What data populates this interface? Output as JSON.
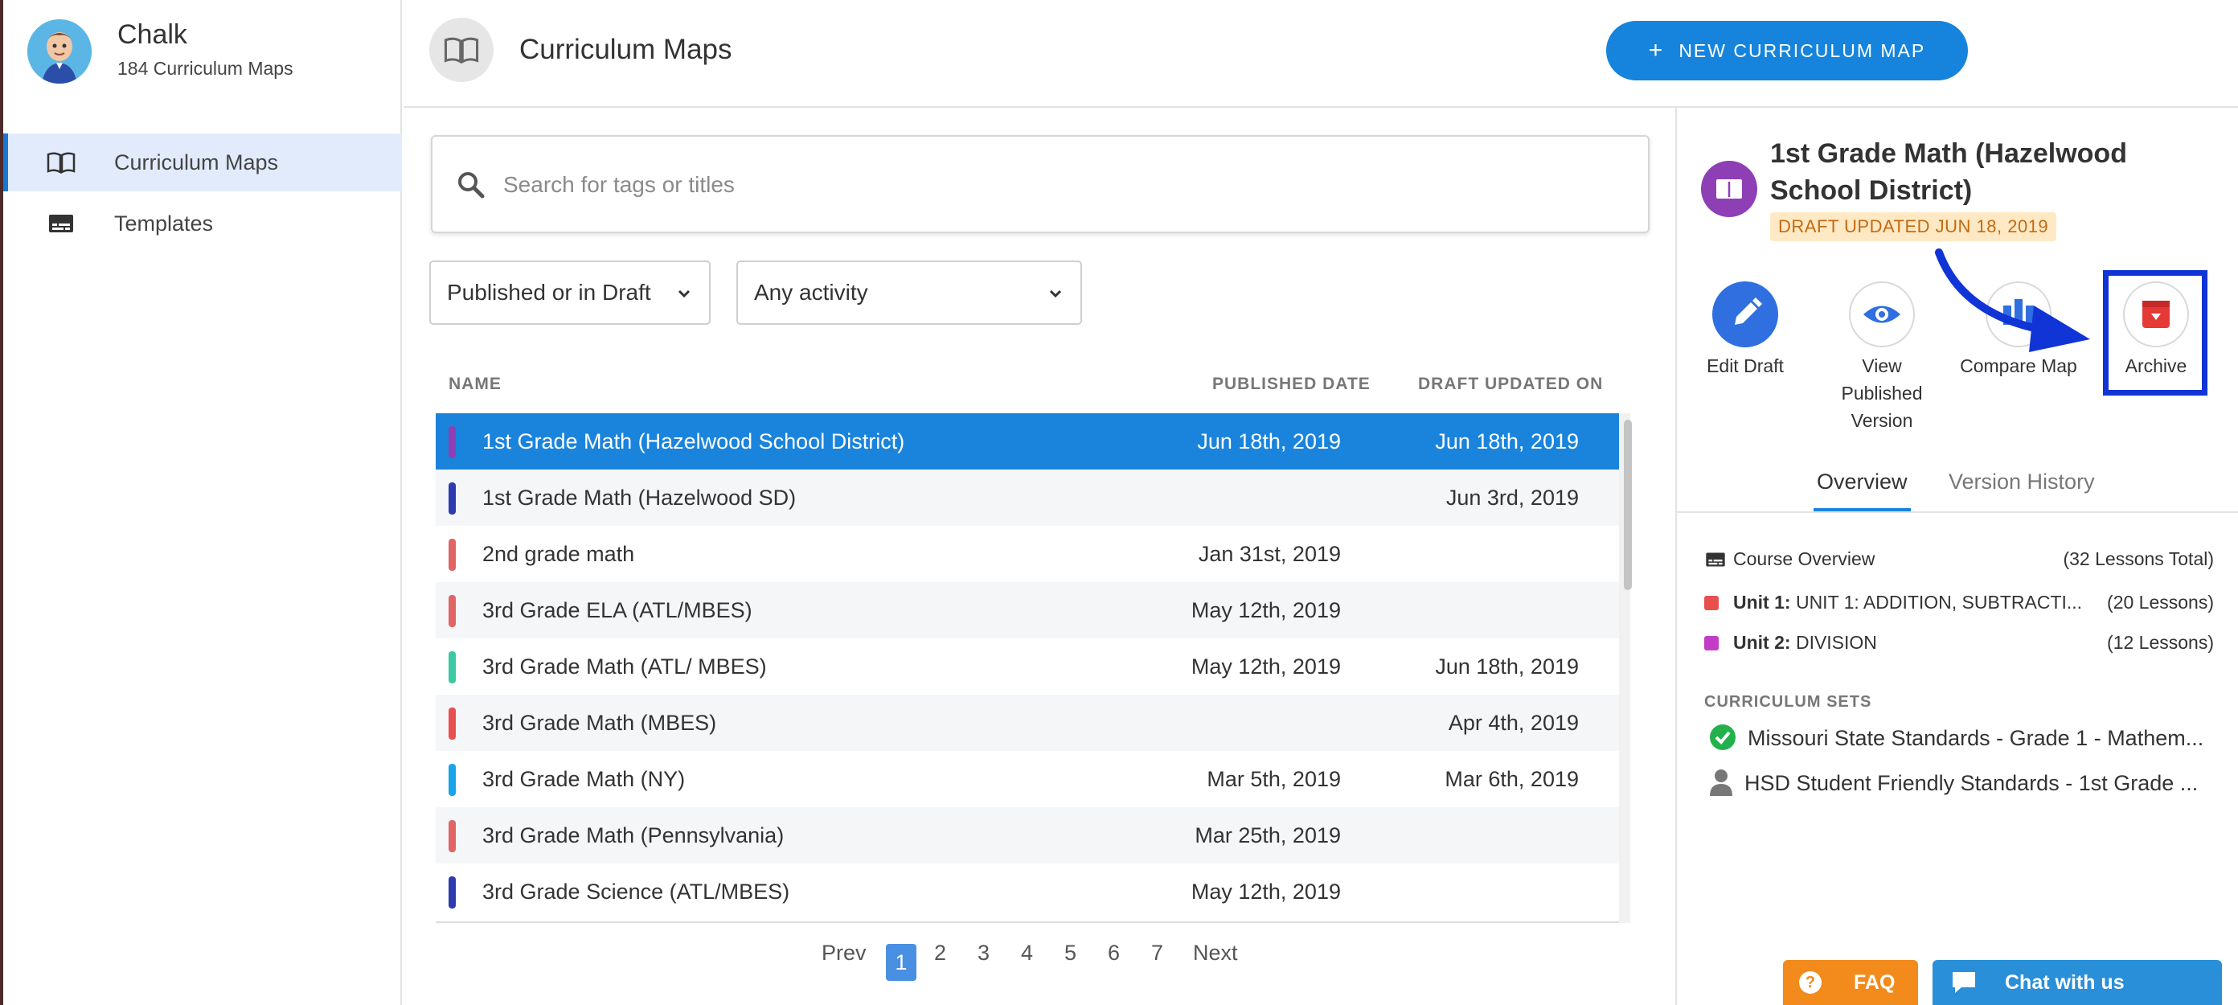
{
  "sidebar": {
    "app_name": "Chalk",
    "map_count": "184 Curriculum Maps",
    "items": [
      {
        "label": "Curriculum Maps",
        "icon": "book-icon",
        "active": true
      },
      {
        "label": "Templates",
        "icon": "template-icon",
        "active": false
      }
    ]
  },
  "header": {
    "title": "Curriculum Maps",
    "new_button_plus": "+",
    "new_button": "NEW CURRICULUM MAP"
  },
  "search": {
    "placeholder": "Search for tags or titles",
    "value": ""
  },
  "filters": {
    "status": "Published or in Draft",
    "activity": "Any activity"
  },
  "table": {
    "columns": [
      "NAME",
      "PUBLISHED DATE",
      "DRAFT UPDATED ON"
    ],
    "rows": [
      {
        "name": "1st Grade Math (Hazelwood School District)",
        "published": "Jun 18th, 2019",
        "draft": "Jun 18th, 2019",
        "color": "#8e3fb5"
      },
      {
        "name": "1st Grade Math (Hazelwood SD)",
        "published": "",
        "draft": "Jun 3rd, 2019",
        "color": "#2c3cb0"
      },
      {
        "name": "2nd grade math",
        "published": "Jan 31st, 2019",
        "draft": "",
        "color": "#e06666"
      },
      {
        "name": "3rd Grade ELA (ATL/MBES)",
        "published": "May 12th, 2019",
        "draft": "",
        "color": "#e06666"
      },
      {
        "name": "3rd Grade Math (ATL/ MBES)",
        "published": "May 12th, 2019",
        "draft": "Jun 18th, 2019",
        "color": "#3cc9a4"
      },
      {
        "name": "3rd Grade Math (MBES)",
        "published": "",
        "draft": "Apr 4th, 2019",
        "color": "#e85050"
      },
      {
        "name": "3rd Grade Math (NY)",
        "published": "Mar 5th, 2019",
        "draft": "Mar 6th, 2019",
        "color": "#1aa3e8"
      },
      {
        "name": "3rd Grade Math (Pennsylvania)",
        "published": "Mar 25th, 2019",
        "draft": "",
        "color": "#e06666"
      },
      {
        "name": "3rd Grade Science (ATL/MBES)",
        "published": "May 12th, 2019",
        "draft": "",
        "color": "#2c3cb0"
      }
    ]
  },
  "pagination": {
    "prev": "Prev",
    "pages": [
      "1",
      "2",
      "3",
      "4",
      "5",
      "6",
      "7"
    ],
    "current": "1",
    "next": "Next"
  },
  "detail": {
    "title": "1st Grade Math (Hazelwood School District)",
    "status": "DRAFT UPDATED JUN 18, 2019",
    "actions": [
      {
        "label": "Edit Draft",
        "icon": "pencil-icon"
      },
      {
        "label": "View Published Version",
        "icon": "eye-icon"
      },
      {
        "label": "Compare Map",
        "icon": "compare-icon"
      },
      {
        "label": "Archive",
        "icon": "archive-icon"
      }
    ],
    "tabs": [
      "Overview",
      "Version History"
    ],
    "overview": {
      "course_label": "Course Overview",
      "course_total": "(32 Lessons Total)",
      "units": [
        {
          "num": "Unit 1:",
          "name": "UNIT 1: ADDITION, SUBTRACTI...",
          "lessons": "(20 Lessons)",
          "color": "#e85050"
        },
        {
          "num": "Unit 2:",
          "name": "DIVISION",
          "lessons": "(12 Lessons)",
          "color": "#c23cc6"
        }
      ]
    },
    "sets_header": "CURRICULUM SETS",
    "sets": [
      {
        "name": "Missouri State Standards - Grade 1 - Mathem...",
        "icon": "check-circle-icon"
      },
      {
        "name": "HSD Student Friendly Standards - 1st Grade ...",
        "icon": "person-icon"
      }
    ]
  },
  "support": {
    "faq_icon": "?",
    "faq": "FAQ",
    "chat": "Chat with us"
  },
  "colors": {
    "accent": "#1a84dc",
    "archive": "#e53935",
    "annotation": "#1034d6"
  }
}
